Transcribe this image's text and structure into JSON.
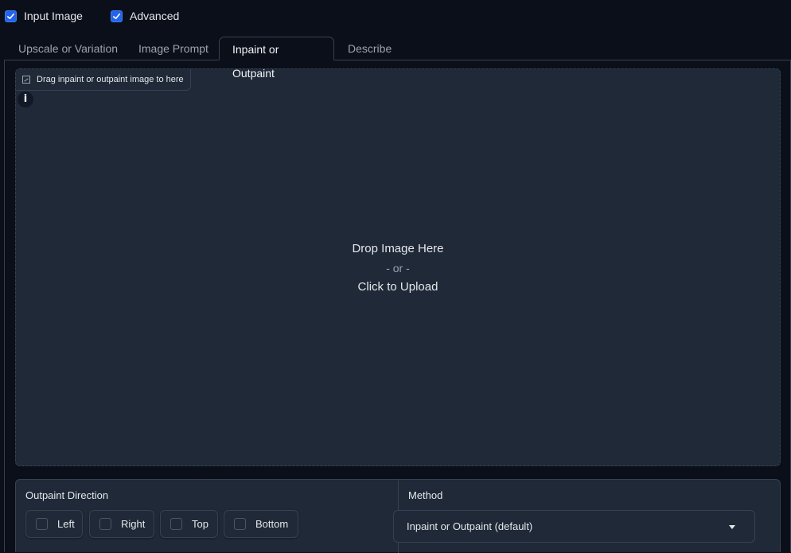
{
  "options": {
    "input_image": {
      "label": "Input Image",
      "checked": true
    },
    "advanced": {
      "label": "Advanced",
      "checked": true
    }
  },
  "tabs": [
    {
      "label": "Upscale or Variation",
      "active": false
    },
    {
      "label": "Image Prompt",
      "active": false
    },
    {
      "label": "Inpaint or Outpaint",
      "active": true
    },
    {
      "label": "Describe",
      "active": false
    }
  ],
  "upload": {
    "label": "Drag inpaint or outpaint image to here",
    "info_badge": "i",
    "drop_text": "Drop Image Here",
    "or_text": "- or -",
    "click_text": "Click to Upload"
  },
  "outpaint": {
    "label": "Outpaint Direction",
    "directions": [
      {
        "label": "Left",
        "checked": false
      },
      {
        "label": "Right",
        "checked": false
      },
      {
        "label": "Top",
        "checked": false
      },
      {
        "label": "Bottom",
        "checked": false
      }
    ]
  },
  "method": {
    "label": "Method",
    "selected": "Inpaint or Outpaint (default)"
  },
  "colors": {
    "background": "#0b0f19",
    "panel": "#1f2937",
    "border": "#374151",
    "accent": "#2563eb"
  }
}
